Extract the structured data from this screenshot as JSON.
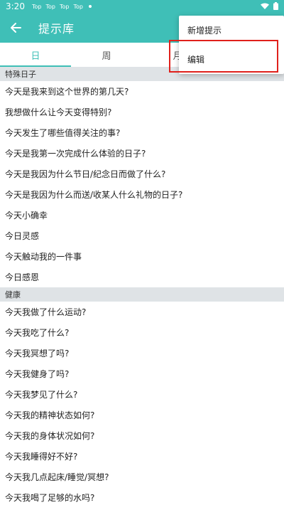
{
  "status_bar": {
    "time": "3:20",
    "notifications": [
      "Top",
      "Top",
      "Top",
      "Top"
    ]
  },
  "app_bar": {
    "title": "提示库"
  },
  "tabs": [
    {
      "label": "日",
      "active": true
    },
    {
      "label": "周",
      "active": false
    },
    {
      "label": "月",
      "active": false
    },
    {
      "label": "",
      "active": false
    }
  ],
  "sections": [
    {
      "title": "特殊日子",
      "items": [
        "今天是我来到这个世界的第几天?",
        "我想做什么让今天变得特别?",
        "今天发生了哪些值得关注的事?",
        "今天是我第一次完成什么体验的日子?",
        "今天是我因为什么节日/纪念日而做了什么?",
        "今天是我因为什么而送/收某人什么礼物的日子?",
        "今天小确幸",
        "今日灵感",
        "今天触动我的一件事",
        "今日感恩"
      ]
    },
    {
      "title": "健康",
      "items": [
        "今天我做了什么运动?",
        "今天我吃了什么?",
        "今天我冥想了吗?",
        "今天我健身了吗?",
        "今天我梦见了什么?",
        "今天我的精神状态如何?",
        "今天我的身体状况如何?",
        "今天我睡得好不好?",
        "今天我几点起床/睡觉/冥想?",
        "今天我喝了足够的水吗?"
      ]
    }
  ],
  "menu": {
    "items": [
      "新增提示",
      "编辑"
    ]
  },
  "colors": {
    "primary": "#3fbfb7",
    "section_bg": "#dfe3e6",
    "highlight": "#e0201b"
  }
}
